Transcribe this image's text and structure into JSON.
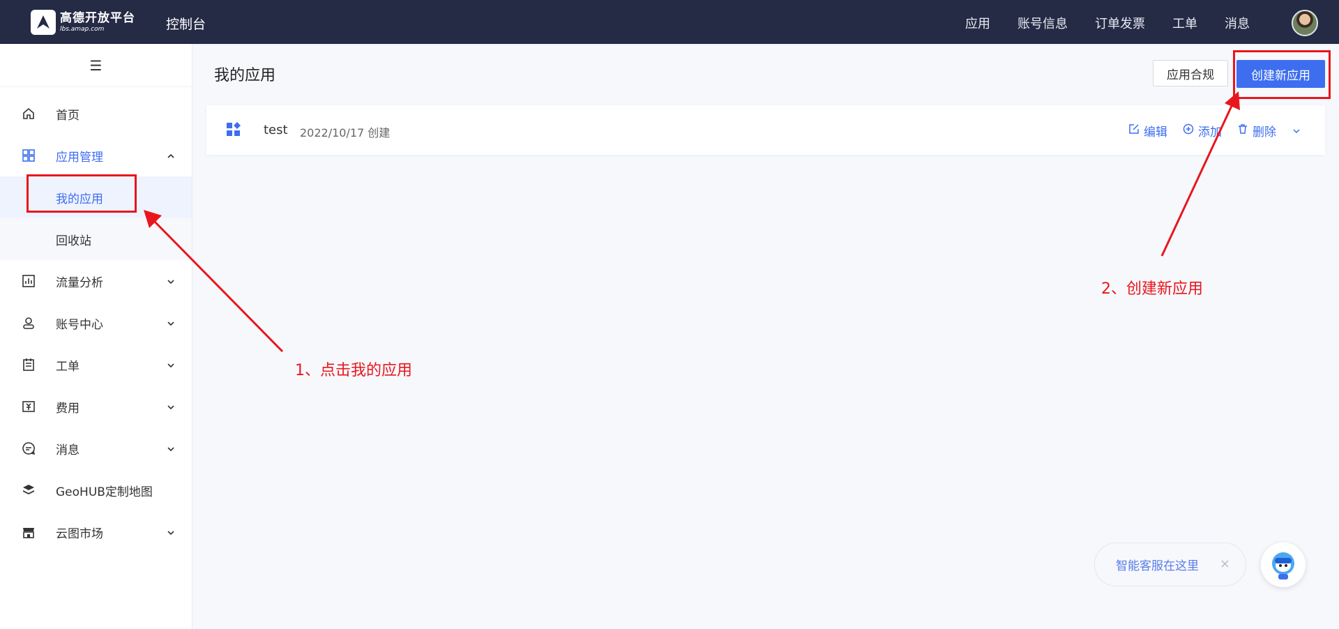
{
  "header": {
    "logo_name": "高德开放平台",
    "logo_domain": "lbs.amap.com",
    "console_label": "控制台",
    "nav": [
      "应用",
      "账号信息",
      "订单发票",
      "工单",
      "消息"
    ]
  },
  "sidebar": {
    "collapse_icon": "menu-icon",
    "items": [
      {
        "label": "首页",
        "icon": "home-icon"
      },
      {
        "label": "应用管理",
        "icon": "app-grid-icon",
        "expanded": true,
        "children": [
          "我的应用",
          "回收站"
        ]
      },
      {
        "label": "流量分析",
        "icon": "chart-icon"
      },
      {
        "label": "账号中心",
        "icon": "user-icon"
      },
      {
        "label": "工单",
        "icon": "ticket-icon"
      },
      {
        "label": "费用",
        "icon": "fee-icon"
      },
      {
        "label": "消息",
        "icon": "message-icon"
      },
      {
        "label": "GeoHUB定制地图",
        "icon": "layers-icon"
      },
      {
        "label": "云图市场",
        "icon": "store-icon"
      }
    ]
  },
  "main": {
    "title": "我的应用",
    "compliance_button": "应用合规",
    "create_button": "创建新应用",
    "apps": [
      {
        "name": "test",
        "created": "2022/10/17 创建",
        "actions": [
          "编辑",
          "添加",
          "删除"
        ]
      }
    ]
  },
  "annotations": {
    "step1": "1、点击我的应用",
    "step2": "2、创建新应用",
    "color": "#e8161d"
  },
  "support": {
    "label": "智能客服在这里",
    "close": "×"
  },
  "colors": {
    "topbar": "#252b45",
    "accent": "#3d6ef0"
  }
}
